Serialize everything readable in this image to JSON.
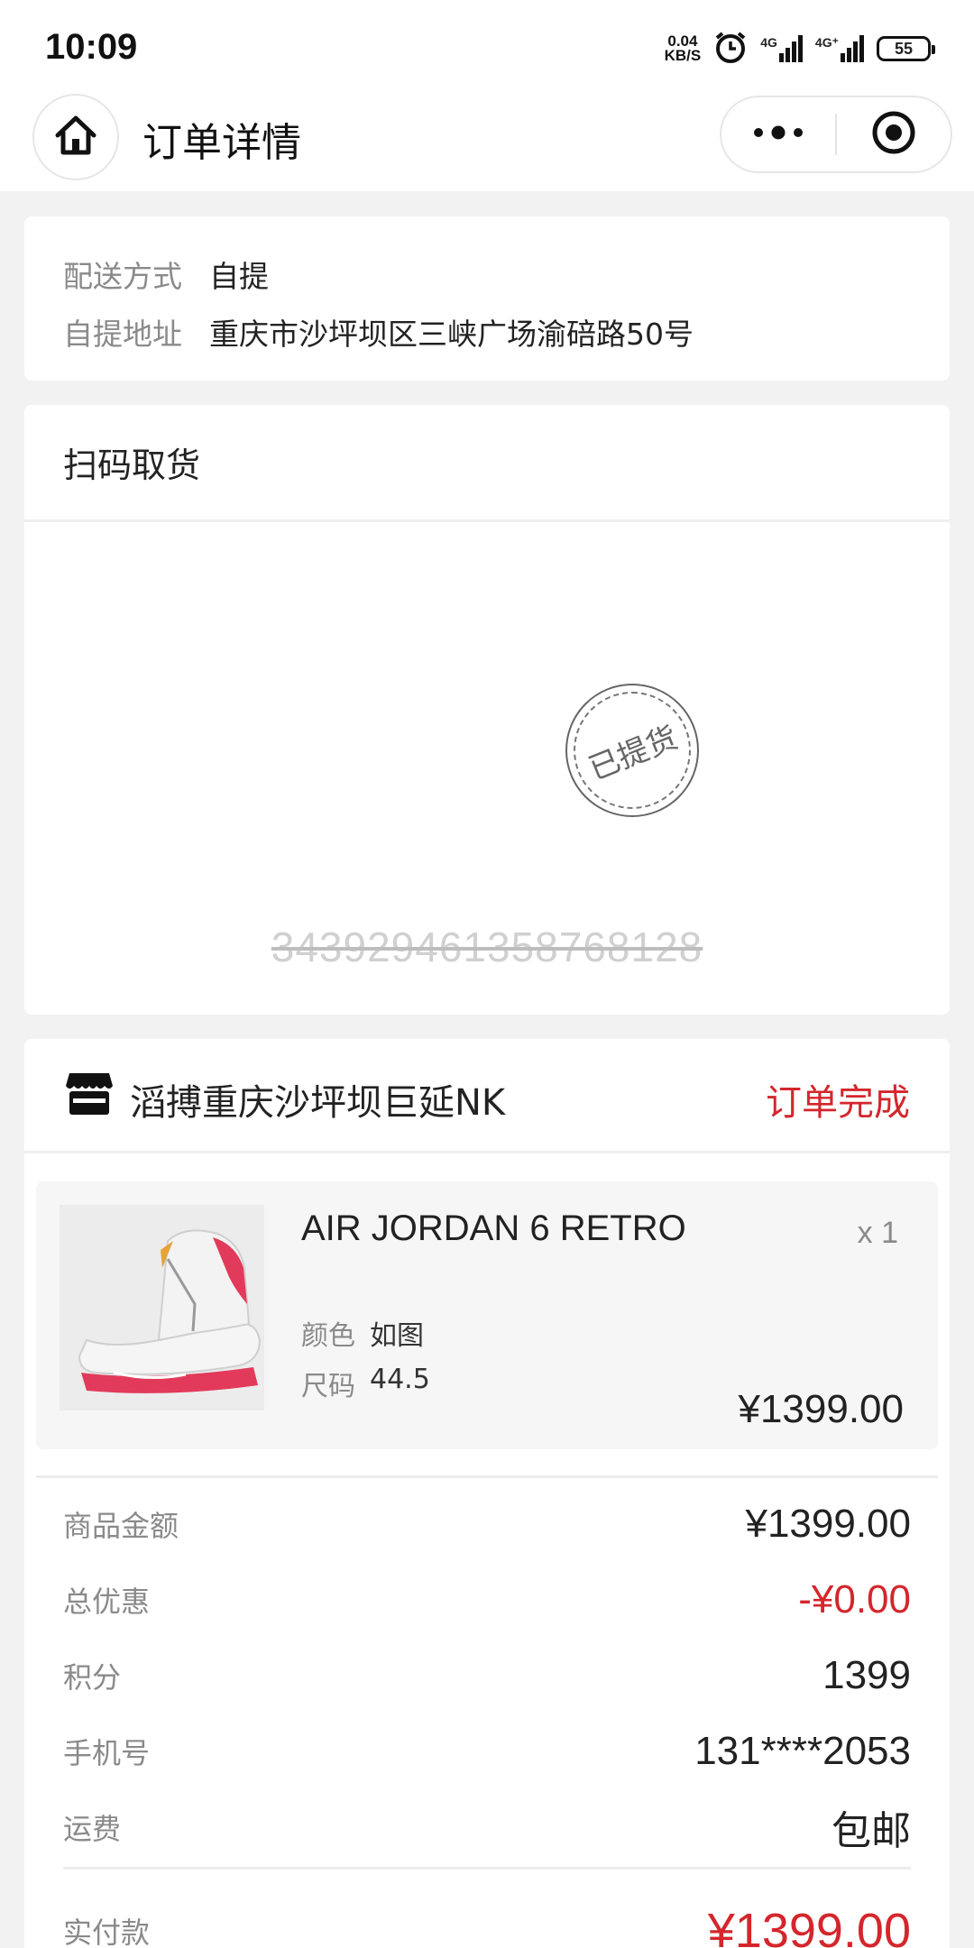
{
  "status_bar": {
    "time": "10:09",
    "net_speed_value": "0.04",
    "net_speed_unit": "KB/S",
    "signal1_label": "4G",
    "signal2_label": "4G⁺",
    "battery": "55"
  },
  "header": {
    "title": "订单详情"
  },
  "delivery": {
    "method_label": "配送方式",
    "method_value": "自提",
    "address_label": "自提地址",
    "address_value": "重庆市沙坪坝区三峡广场渝碚路50号"
  },
  "pickup": {
    "title": "扫码取货",
    "stamp_text": "已提货",
    "code": "343929461358768128"
  },
  "order": {
    "store_name": "滔搏重庆沙坪坝巨延NK",
    "status": "订单完成",
    "product": {
      "name": "AIR JORDAN 6 RETRO",
      "quantity": "x 1",
      "color_label": "颜色",
      "color_value": "如图",
      "size_label": "尺码",
      "size_value": "44.5",
      "price": "¥1399.00"
    },
    "summary": {
      "goods_amount_label": "商品金额",
      "goods_amount": "¥1399.00",
      "discount_label": "总优惠",
      "discount": "-¥0.00",
      "points_label": "积分",
      "points": "1399",
      "phone_label": "手机号",
      "phone": "131****2053",
      "shipping_label": "运费",
      "shipping": "包邮",
      "paid_label": "实付款",
      "paid": "¥1399.00"
    }
  },
  "colors": {
    "accent_red": "#d4262c",
    "background": "#f2f2f2"
  }
}
